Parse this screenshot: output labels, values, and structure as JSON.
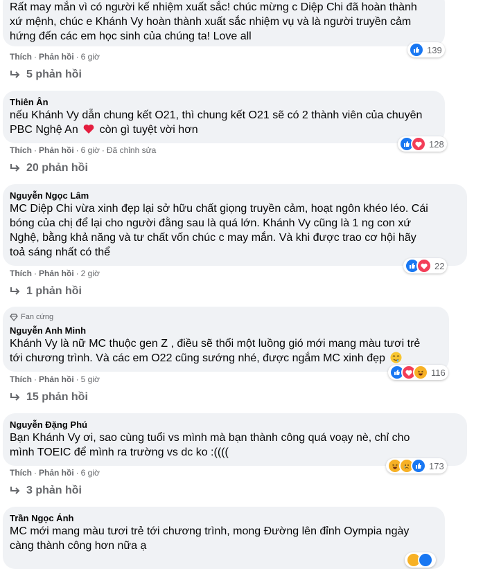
{
  "comments": [
    {
      "author": "",
      "fan_badge": "",
      "lines": [
        "Rất may mắn vì có người kế nhiệm xuất sắc! chúc mừng c Diệp Chi đã hoàn thành",
        "xứ mệnh, chúc e Khánh Vy hoàn thành xuất sắc nhiệm vụ và là người truyền cảm",
        "hứng đến các em học sinh của chúng ta! Love all"
      ],
      "like_label": "Thích",
      "reply_label": "Phản hồi",
      "time": "6 giờ",
      "edited": "",
      "reaction_icons": [
        "like-icon"
      ],
      "reaction_count": "139",
      "replies_label": "5 phản hồi"
    },
    {
      "author": "Thiên Ân",
      "fan_badge": "",
      "lines": [
        "nếu Khánh Vy dẫn chung kết O21, thì chung kết O21 sẽ có 2 thành viên của chuyên",
        "PBC Nghệ An",
        "còn gì tuyệt vời hơn"
      ],
      "like_label": "Thích",
      "reply_label": "Phản hồi",
      "time": "6 giờ",
      "edited": "Đã chỉnh sửa",
      "reaction_icons": [
        "like-icon",
        "heart-icon"
      ],
      "reaction_count": "128",
      "replies_label": "20 phản hồi"
    },
    {
      "author": "Nguyễn Ngọc Lâm",
      "fan_badge": "",
      "lines": [
        "MC Diệp Chi vừa xinh đẹp lại sở hữu chất giọng truyền cảm, hoạt ngôn khéo léo. Cái",
        "bóng của chị để lại cho người đằng sau là quá lớn. Khánh Vy cũng là 1 ng con xứ",
        "Nghệ, bằng khả năng và tư chất vốn chúc c may mắn. Và khi được trao cơ hội hãy",
        "toả sáng nhất có thể"
      ],
      "like_label": "Thích",
      "reply_label": "Phản hồi",
      "time": "2 giờ",
      "edited": "",
      "reaction_icons": [
        "like-icon",
        "heart-icon"
      ],
      "reaction_count": "22",
      "replies_label": "1 phản hồi"
    },
    {
      "author": "Nguyễn Anh Minh",
      "fan_badge": "Fan cứng",
      "lines": [
        "Khánh Vy là nữ MC thuộc gen Z , điều sẽ thổi một luồng gió mới mang màu tươi trẻ",
        "tới chương trình. Và các em O22 cũng sướng nhé, được ngắm MC xinh đẹp"
      ],
      "like_label": "Thích",
      "reply_label": "Phản hồi",
      "time": "5 giờ",
      "edited": "",
      "reaction_icons": [
        "like-icon",
        "heart-icon",
        "haha-icon"
      ],
      "reaction_count": "116",
      "replies_label": "15 phản hồi"
    },
    {
      "author": "Nguyễn Đặng Phú",
      "fan_badge": "",
      "lines": [
        "Bạn Khánh Vy ơi, sao cùng tuổi vs mình mà bạn thành công quá voạy nè, chỉ cho",
        "mình TOEIC để mình ra trường vs dc ko :(((("
      ],
      "like_label": "Thích",
      "reply_label": "Phản hồi",
      "time": "6 giờ",
      "edited": "",
      "reaction_icons": [
        "haha-icon",
        "sad-icon",
        "like-icon"
      ],
      "reaction_count": "173",
      "replies_label": "3 phản hồi"
    },
    {
      "author": "Trần Ngọc Ánh",
      "fan_badge": "",
      "lines": [
        "MC mới mang màu tươi trẻ tới chương trình, mong Đường lên đỉnh Oympia ngày",
        "càng thành công hơn nữa ạ"
      ]
    }
  ],
  "colors": {
    "bubble": "#f0f2f5",
    "like": "#1877f2",
    "heart": "#f33e58",
    "haha": "#f7b125",
    "meta": "#65676b"
  }
}
